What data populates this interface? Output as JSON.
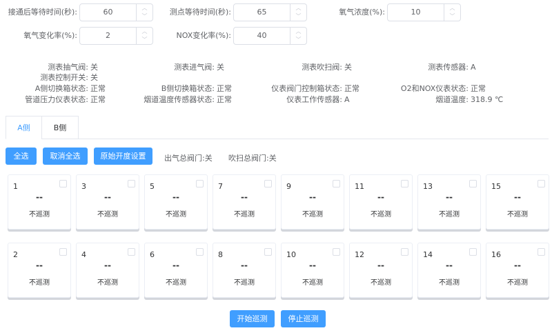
{
  "form": [
    {
      "label": "接通后等待时间(秒):",
      "value": "60"
    },
    {
      "label": "测点等待时间(秒):",
      "value": "65"
    },
    {
      "label": "氧气浓度(%):",
      "value": "10"
    },
    {
      "label": "氧气变化率(%):",
      "value": "2"
    },
    {
      "label": "NOX变化率(%):",
      "value": "40"
    }
  ],
  "status": [
    {
      "label": "测表抽气阀:",
      "value": "关"
    },
    {
      "label": "测表进气阀:",
      "value": "关"
    },
    {
      "label": "测表吹扫阀:",
      "value": "关"
    },
    {
      "label": "测表传感器:",
      "value": "A"
    },
    {
      "label": "测表控制开关:",
      "value": "关"
    },
    {
      "label": "A侧切换箱状态:",
      "value": "正常"
    },
    {
      "label": "B侧切换箱状态:",
      "value": "正常"
    },
    {
      "label": "仪表阀门控制箱状态:",
      "value": "正常"
    },
    {
      "label": "O2和NOX仪表状态:",
      "value": "正常"
    },
    {
      "label": "管道压力仪表状态:",
      "value": "正常"
    },
    {
      "label": "烟道温度传感器状态:",
      "value": "正常"
    },
    {
      "label": "仪表工作传感器:",
      "value": "A"
    },
    {
      "label": "烟道温度:",
      "value": "318.9 ℃"
    }
  ],
  "tabs": [
    "A侧",
    "B侧"
  ],
  "toolbar": {
    "select_all": "全选",
    "deselect_all": "取消全选",
    "original_setting": "原始开度设置",
    "outlet_valve": "出气总阀门:关",
    "purge_valve": "吹扫总阀门:关"
  },
  "cards": [
    {
      "id": "1",
      "value": "--",
      "state": "不巡测"
    },
    {
      "id": "3",
      "value": "--",
      "state": "不巡测"
    },
    {
      "id": "5",
      "value": "--",
      "state": "不巡测"
    },
    {
      "id": "7",
      "value": "--",
      "state": "不巡测"
    },
    {
      "id": "9",
      "value": "--",
      "state": "不巡测"
    },
    {
      "id": "11",
      "value": "--",
      "state": "不巡测"
    },
    {
      "id": "13",
      "value": "--",
      "state": "不巡测"
    },
    {
      "id": "15",
      "value": "--",
      "state": "不巡测"
    },
    {
      "id": "2",
      "value": "--",
      "state": "不巡测"
    },
    {
      "id": "4",
      "value": "--",
      "state": "不巡测"
    },
    {
      "id": "6",
      "value": "--",
      "state": "不巡测"
    },
    {
      "id": "8",
      "value": "--",
      "state": "不巡测"
    },
    {
      "id": "10",
      "value": "--",
      "state": "不巡测"
    },
    {
      "id": "12",
      "value": "--",
      "state": "不巡测"
    },
    {
      "id": "14",
      "value": "--",
      "state": "不巡测"
    },
    {
      "id": "16",
      "value": "--",
      "state": "不巡测"
    }
  ],
  "actions": {
    "start": "开始巡测",
    "stop": "停止巡测"
  }
}
